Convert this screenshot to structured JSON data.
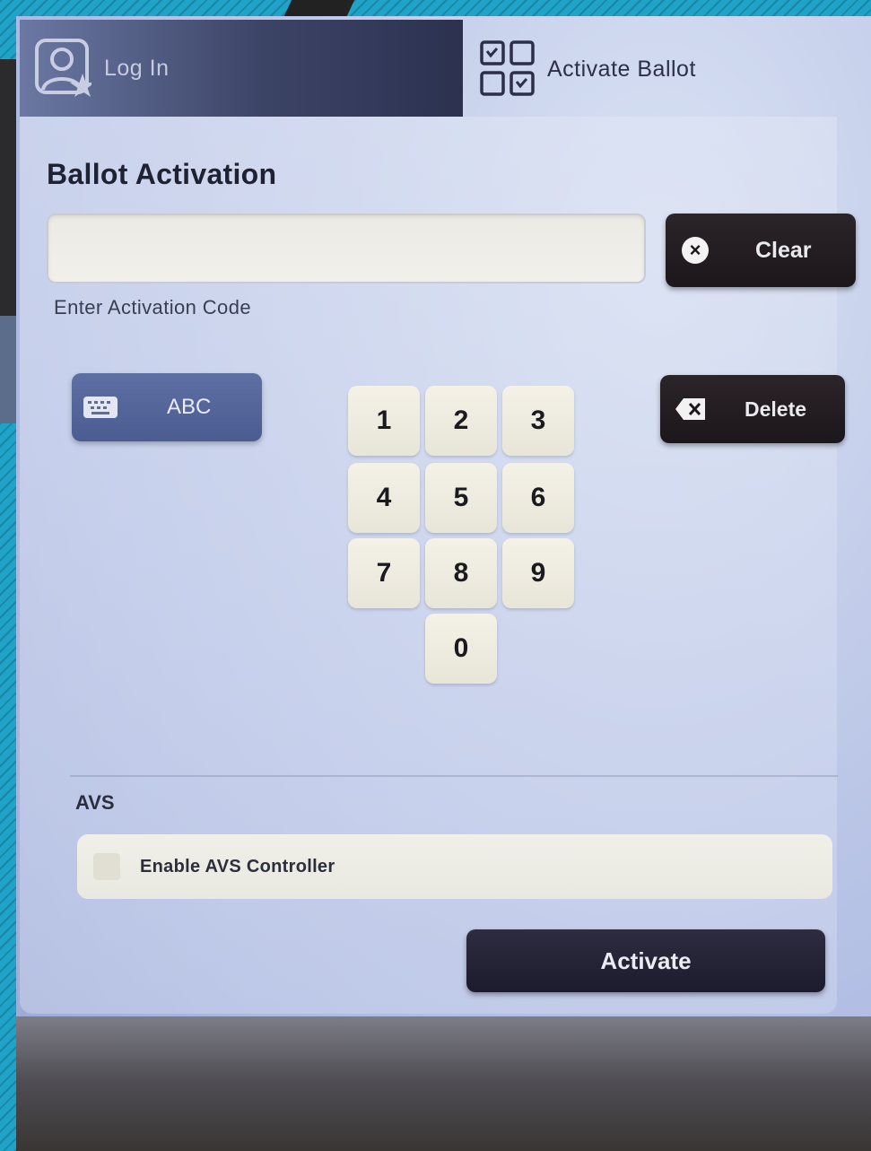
{
  "header": {
    "login_tab": {
      "label": "Log In",
      "icon": "user-star-icon"
    },
    "activate_tab": {
      "label": "Activate Ballot",
      "icon": "ballot-grid-icon"
    }
  },
  "main": {
    "title": "Ballot Activation",
    "activation_code": {
      "value": "",
      "hint": "Enter Activation Code"
    },
    "clear_button": {
      "label": "Clear",
      "icon": "x-circle-icon"
    },
    "abc_button": {
      "label": "ABC",
      "icon": "keyboard-icon"
    },
    "delete_button": {
      "label": "Delete",
      "icon": "backspace-icon"
    },
    "keypad": [
      "1",
      "2",
      "3",
      "4",
      "5",
      "6",
      "7",
      "8",
      "9",
      "0"
    ]
  },
  "avs": {
    "section_label": "AVS",
    "enable_label": "Enable AVS Controller",
    "checked": false
  },
  "activate_button": {
    "label": "Activate"
  },
  "colors": {
    "frame": "#1fa3c9",
    "login_tab": "#3c4466",
    "abc_button": "#4b5c92",
    "dark_button": "#1c171b",
    "key": "#f4f1e6"
  }
}
